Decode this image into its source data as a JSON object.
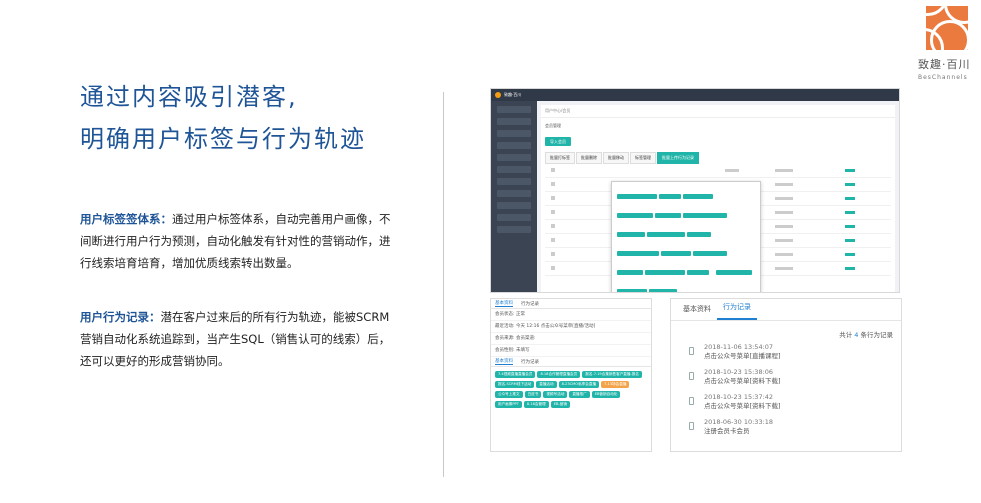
{
  "title": {
    "line1": "通过内容吸引潜客,",
    "line2": "明确用户标签与行为轨迹"
  },
  "para1": {
    "head": "用户标签签体系：",
    "body": "通过用户标签体系，自动完善用户画像，不间断进行用户行为预测，自动化触发有针对性的营销动作，进行线索培育培育，增加优质线索转出数量。"
  },
  "para2": {
    "head": "用户行为记录：",
    "body": "潜在客户过来后的所有行为轨迹，能被SCRM营销自动化系统追踪到，当产生SQL（销售认可的线索）后，还可以更好的形成营销协同。"
  },
  "logo": {
    "name": "致趣·百川",
    "sub": "BesChannels",
    "color": "#ea7a3d"
  },
  "screenshot": {
    "brand": "致趣·百川",
    "crumb": "用户中心/会员",
    "section": "会员管理",
    "add_label": "导入会员",
    "tabs": [
      "批量打标签",
      "批量删除",
      "批量移动",
      "标签管理",
      "批量上传行为记录"
    ]
  },
  "left_panel": {
    "tabs": [
      "基本资料",
      "行为记录"
    ],
    "rows": [
      "会员状态:   正常",
      "最近活动:   今天 12:16 点击公众号菜单[直播/活动]",
      "会员来源:                      会员渠道:",
      "会员性别:   未填写"
    ],
    "tabs2": [
      "基本资料",
      "行为记录"
    ],
    "tags": [
      "7.4视频直播直播会员",
      "8.18合作管理直播会员",
      "报名-7.19合集销售客户直播-报名",
      "报名-SCRM线下活动",
      "直播活动",
      "8.23CMO私享会直播",
      "7.13场会直播",
      "公众号上推文",
      "白皮书",
      "视频号活动",
      "直播推广",
      "EB营销自动化",
      "用户画像PPT",
      "8.18会管理",
      "EB-营销"
    ],
    "orange_tag_index": 6
  },
  "records": {
    "tabs": [
      "基本资料",
      "行为记录"
    ],
    "total_prefix": "共计",
    "total_count": "4",
    "total_suffix": "条行为记录",
    "items": [
      {
        "time": "2018-11-06 13:54:07",
        "action": "点击公众号菜单[直播课程]"
      },
      {
        "time": "2018-10-23 15:38:06",
        "action": "点击公众号菜单[资料下载]"
      },
      {
        "time": "2018-10-23 15:37:42",
        "action": "点击公众号菜单[资料下载]"
      },
      {
        "time": "2018-06-30 10:33:18",
        "action": "注册会员卡会员"
      }
    ]
  }
}
